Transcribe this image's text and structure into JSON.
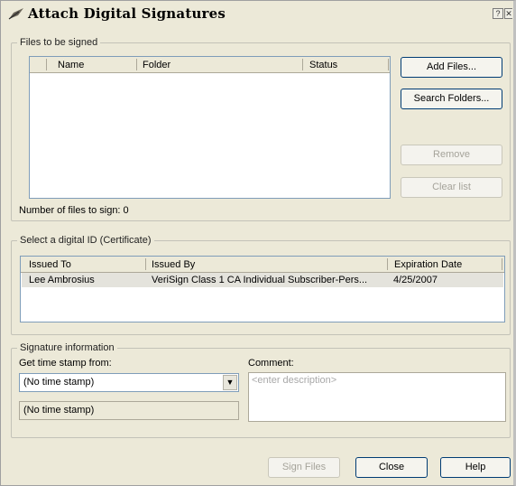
{
  "window": {
    "title": "Attach Digital Signatures",
    "help_glyph": "?",
    "close_glyph": "✕"
  },
  "files": {
    "legend": "Files to be signed",
    "columns": [
      "Name",
      "Folder",
      "Status"
    ],
    "count_label": "Number of files to sign: 0",
    "add_label": "Add Files...",
    "search_label": "Search Folders...",
    "remove_label": "Remove",
    "clear_label": "Clear list"
  },
  "certificate": {
    "legend": "Select a digital ID (Certificate)",
    "columns": [
      "Issued To",
      "Issued By",
      "Expiration Date"
    ],
    "rows": [
      {
        "issued_to": "Lee Ambrosius",
        "issued_by": "VeriSign Class 1 CA Individual Subscriber-Pers...",
        "expiration": "4/25/2007"
      }
    ]
  },
  "signature": {
    "legend": "Signature information",
    "timestamp_label": "Get time stamp from:",
    "timestamp_value": "(No time stamp)",
    "timestamp_display": "(No time stamp)",
    "comment_label": "Comment:",
    "comment_placeholder": "<enter description>"
  },
  "footer": {
    "sign_label": "Sign Files",
    "close_label": "Close",
    "help_label": "Help"
  }
}
